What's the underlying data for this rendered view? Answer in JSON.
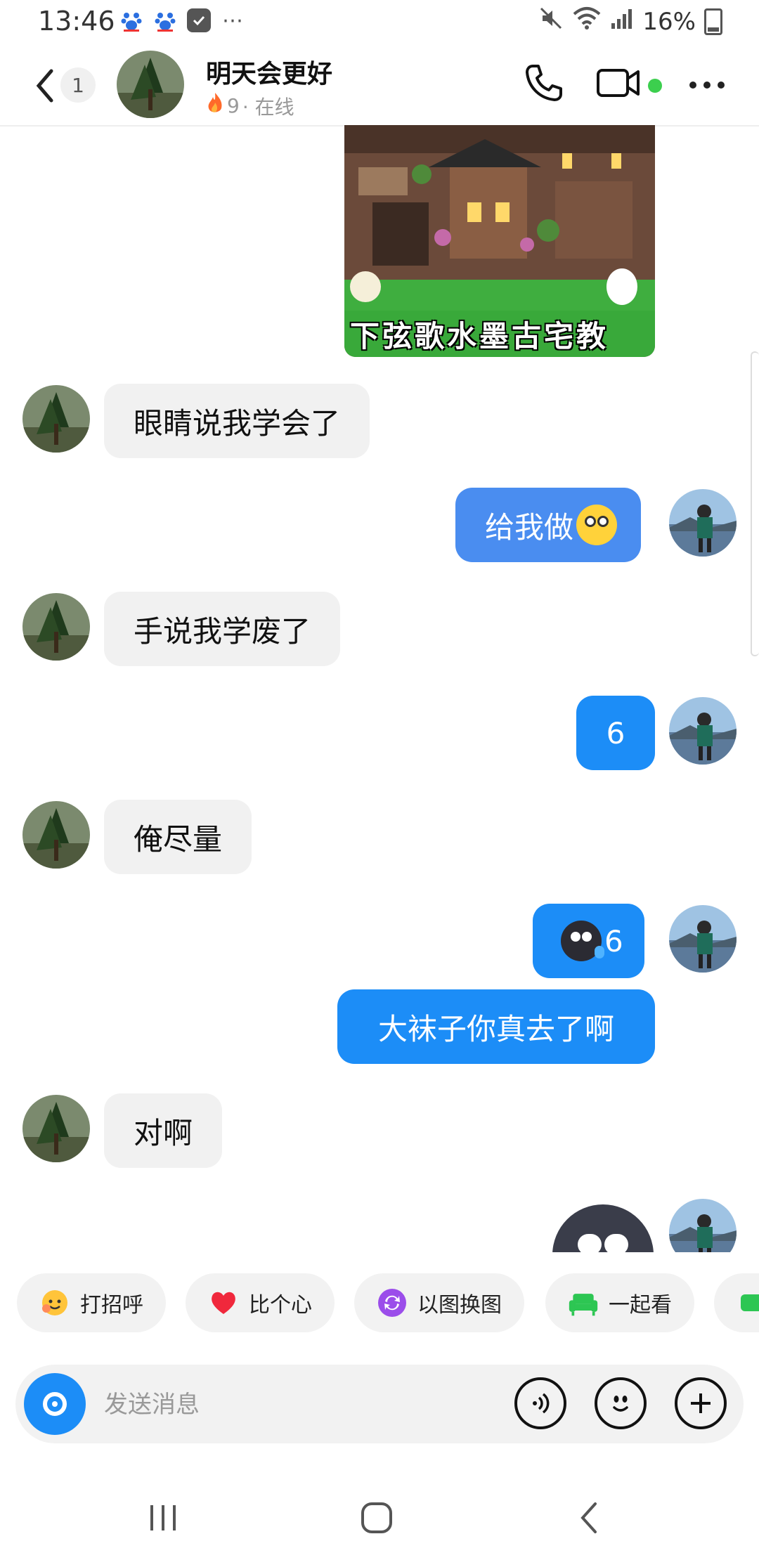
{
  "status_bar": {
    "time": "13:46",
    "left_icons": [
      "paw-icon",
      "paw-icon",
      "check-icon",
      "more-dots-icon"
    ],
    "battery": "16%",
    "right_icons": [
      "mute-icon",
      "wifi-icon",
      "signal-icon",
      "battery-icon"
    ]
  },
  "header": {
    "back_icon": "chevron-left-icon",
    "unread_count": "1",
    "contact_name": "明天会更好",
    "streak_count": "9",
    "presence": "· 在线",
    "actions": [
      "phone-icon",
      "video-icon",
      "more-icon"
    ],
    "online_color": "#3ccf4e"
  },
  "chat": {
    "shared_image_caption": "下弦歌水墨古宅教",
    "messages": [
      {
        "side": "in",
        "text": "眼睛说我学会了"
      },
      {
        "side": "out",
        "text": "给我做",
        "emoji": "dazed-face"
      },
      {
        "side": "in",
        "text": "手说我学废了"
      },
      {
        "side": "out",
        "text": "6"
      },
      {
        "side": "in",
        "text": "俺尽量"
      },
      {
        "side": "out",
        "text": "6",
        "emoji": "crying-dark-face"
      },
      {
        "side": "out",
        "text": "大袜子你真去了啊"
      },
      {
        "side": "in",
        "text": "对啊"
      }
    ]
  },
  "quick_actions": [
    {
      "label": "打招呼",
      "icon": "wave-emoji-icon"
    },
    {
      "label": "比个心",
      "icon": "heart-icon"
    },
    {
      "label": "以图换图",
      "icon": "image-swap-icon"
    },
    {
      "label": "一起看",
      "icon": "sofa-icon"
    }
  ],
  "input_bar": {
    "placeholder": "发送消息",
    "camera_icon": "camera-icon",
    "buttons": [
      "voice-icon",
      "emoji-icon",
      "plus-icon"
    ]
  },
  "colors": {
    "accent": "#1c8df7",
    "bubble_in": "#f1f1f1",
    "chip_bg": "#f2f2f2"
  },
  "nav_bar": [
    "recents-icon",
    "home-icon",
    "back-icon"
  ]
}
